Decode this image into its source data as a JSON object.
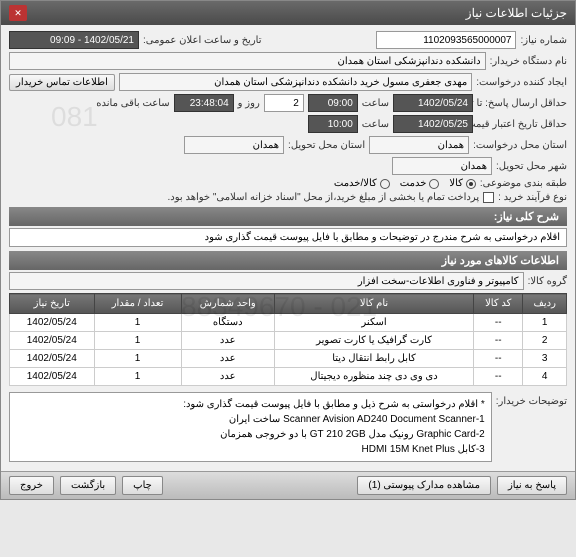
{
  "window": {
    "title": "جزئیات اطلاعات نیاز"
  },
  "fields": {
    "needNo_label": "شماره نیاز:",
    "needNo_value": "1102093565000007",
    "announceDate_label": "تاریخ و ساعت اعلان عمومی:",
    "announceDate_value": "1402/05/21 - 09:09",
    "buyerOrg_label": "نام دستگاه خریدار:",
    "buyerOrg_value": "دانشکده دندانپزشکی استان همدان",
    "requester_label": "ایجاد کننده درخواست:",
    "requester_value": "مهدی جعفری مسول خرید دانشکده دندانپزشکی استان همدان",
    "contact_btn": "اطلاعات تماس خریدار",
    "deadline_label": "حداقل ارسال پاسخ: تا تاریخ:",
    "deadline_date": "1402/05/24",
    "deadline_time_label": "ساعت",
    "deadline_time": "09:00",
    "days_val": "2",
    "days_label": "روز و",
    "countdown": "23:48:04",
    "countdown_suffix": "ساعت باقی مانده",
    "validity_label": "حداقل تاریخ اعتبار قیمت: تا تاریخ:",
    "validity_date": "1402/05/25",
    "validity_time_label": "ساعت",
    "validity_time": "10:00",
    "reqProvince_label": "استان محل درخواست:",
    "reqProvince_value": "همدان",
    "deliverProvince_label": "استان محل تحویل:",
    "deliverProvince_value": "همدان",
    "deliverCity_label": "شهر محل تحویل:",
    "deliverCity_value": "همدان",
    "subjectCat_label": "طبقه بندی موضوعی:",
    "cat_goods": "کالا",
    "cat_service": "خدمت",
    "cat_goodsservice": "کالا/خدمت",
    "buyProcess_label": "نوع فرآیند خرید :",
    "buyProcess_note": "پرداخت تمام یا بخشی از مبلغ خرید،از محل \"اسناد خزانه اسلامی\" خواهد بود."
  },
  "summary": {
    "header": "شرح کلی نیاز:",
    "text": "اقلام درخواستی به شرح مندرج در توضیحات و مطابق با فایل پیوست قیمت گذاری شود"
  },
  "itemsSection": {
    "header": "اطلاعات کالاهای مورد نیاز",
    "group_label": "گروه کالا:",
    "group_value": "کامپیوتر و فناوری اطلاعات-سخت افزار"
  },
  "table": {
    "headers": [
      "ردیف",
      "کد کالا",
      "نام کالا",
      "واحد شمارش",
      "تعداد / مقدار",
      "تاریخ نیاز"
    ],
    "rows": [
      [
        "1",
        "--",
        "اسکنر",
        "دستگاه",
        "1",
        "1402/05/24"
      ],
      [
        "2",
        "--",
        "کارت گرافیک یا کارت تصویر",
        "عدد",
        "1",
        "1402/05/24"
      ],
      [
        "3",
        "--",
        "کابل رابط انتقال دیتا",
        "عدد",
        "1",
        "1402/05/24"
      ],
      [
        "4",
        "--",
        "دی وی دی چند منظوره دیجیتال",
        "عدد",
        "1",
        "1402/05/24"
      ]
    ]
  },
  "buyerNotes": {
    "label": "توضیحات خریدار:",
    "lines": [
      "* اقلام درخواستی به شرح ذیل و مطابق با فایل پیوست قیمت گذاری شود:",
      "1-Scanner Avision AD240 Document Scanner ساخت ایران",
      "2-Graphic Card رونیک مدل GT 210 2GB با دو خروجی همزمان",
      "3-کابل HDMI 15M Knet Plus"
    ]
  },
  "footer": {
    "respond": "پاسخ به نیاز",
    "attachments": "مشاهده مدارک پیوستی (1)",
    "print": "چاپ",
    "back": "بازگشت",
    "exit": "خروج"
  },
  "watermarks": {
    "w1": "081",
    "w2": "021 - 88349670"
  }
}
